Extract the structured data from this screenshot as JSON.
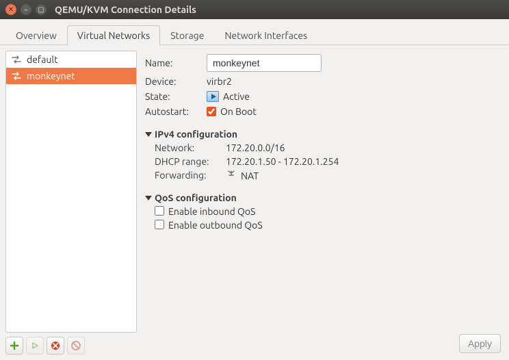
{
  "window": {
    "title": "QEMU/KVM Connection Details"
  },
  "tabs": {
    "overview": "Overview",
    "virtual_networks": "Virtual Networks",
    "storage": "Storage",
    "network_interfaces": "Network Interfaces"
  },
  "sidebar": {
    "items": [
      {
        "name": "default",
        "selected": false
      },
      {
        "name": "monkeynet",
        "selected": true
      }
    ]
  },
  "detail": {
    "name_label": "Name:",
    "name_value": "monkeynet",
    "device_label": "Device:",
    "device_value": "virbr2",
    "state_label": "State:",
    "state_value": "Active",
    "autostart_label": "Autostart:",
    "autostart_checked": true,
    "autostart_text": "On Boot",
    "ipv4_header": "IPv4 configuration",
    "ipv4_network_label": "Network:",
    "ipv4_network_value": "172.20.0.0/16",
    "dhcp_label": "DHCP range:",
    "dhcp_value": "172.20.1.50 - 172.20.1.254",
    "forwarding_label": "Forwarding:",
    "forwarding_value": "NAT",
    "qos_header": "QoS configuration",
    "qos_inbound_label": "Enable inbound QoS",
    "qos_inbound_checked": false,
    "qos_outbound_label": "Enable outbound QoS",
    "qos_outbound_checked": false
  },
  "buttons": {
    "apply": "Apply"
  }
}
